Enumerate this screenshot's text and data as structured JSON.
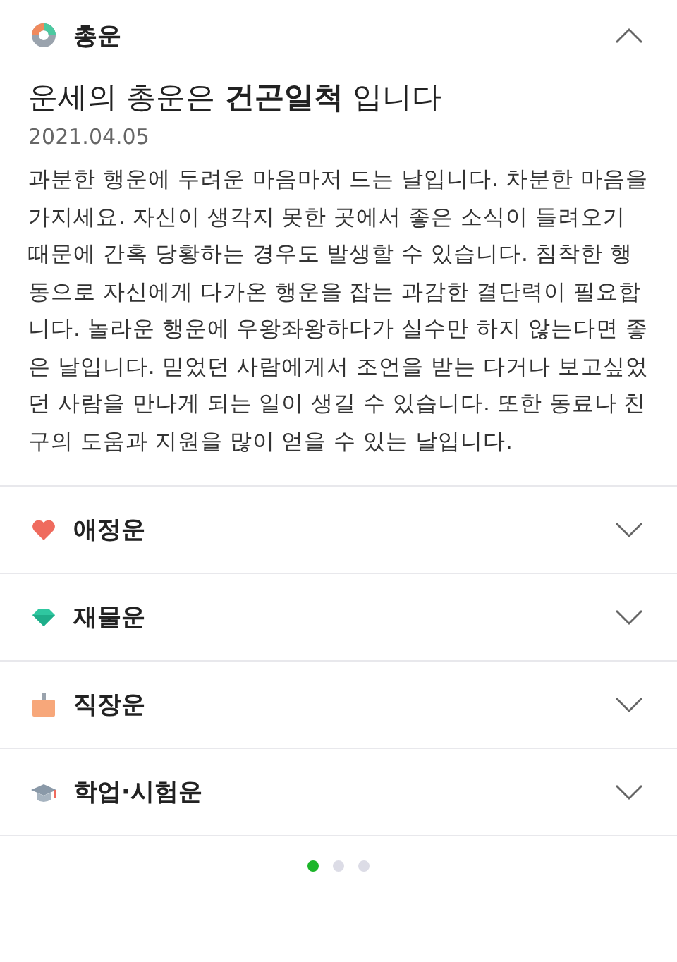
{
  "sections": [
    {
      "kind": "total",
      "label": "총운",
      "expanded": true,
      "headline": "운세의 총운은 **건곤일척** 입니다",
      "date": "2021.04.05",
      "body": "과분한 행운에 두려운 마음마저 드는 날입니다. 차분한 마음을 가지세요. 자신이 생각지 못한 곳에서 좋은 소식이 들려오기 때문에 간혹 당황하는 경우도 발생할 수 있습니다. 침착한 행동으로 자신에게 다가온 행운을 잡는 과감한 결단력이 필요합니다. 놀라운 행운에 우왕좌왕하다가 실수만 하지 않는다면 좋은 날입니다. 믿었던 사람에게서 조언을 받는 다거나 보고싶었던 사람을 만나게 되는 일이 생길 수 있습니다. 또한 동료나 친구의 도움과 지원을 많이 얻을 수 있는 날입니다."
    },
    {
      "kind": "love",
      "label": "애정운",
      "expanded": false
    },
    {
      "kind": "money",
      "label": "재물운",
      "expanded": false
    },
    {
      "kind": "work",
      "label": "직장운",
      "expanded": false
    },
    {
      "kind": "study",
      "label": "학업·시험운",
      "expanded": false
    }
  ],
  "pager": [
    {
      "selected": true
    },
    {
      "selected": false
    },
    {
      "selected": false
    }
  ]
}
